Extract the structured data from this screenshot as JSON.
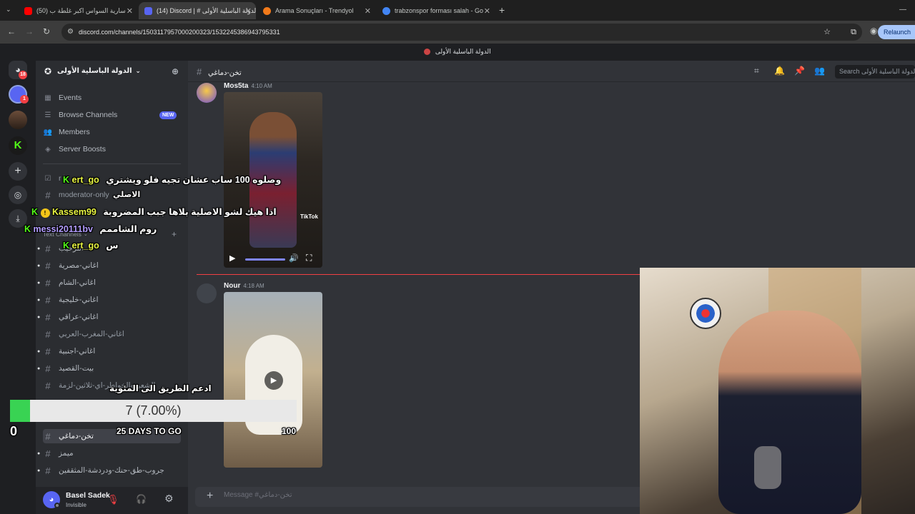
{
  "browser": {
    "tabs": [
      {
        "title": "(50) سارية السواس اكبر غلطة ب"
      },
      {
        "title": "(14) Discord | # الدولة الباسلية الأولى"
      },
      {
        "title": "Arama Sonuçları - Trendyol"
      },
      {
        "title": "trabzonspor forması salah - Go"
      }
    ],
    "url": "discord.com/channels/1503117957000200323/1532245386943795331",
    "relaunch_label": "Relaunch"
  },
  "discord": {
    "top_title": "الدولة الباسلية الأولى",
    "guild_badges": [
      "18",
      "1"
    ],
    "server": {
      "name": "الدولة الباسلية الأولى"
    },
    "nav_items": [
      {
        "label": "Events",
        "icon": "calendar-icon"
      },
      {
        "label": "Browse Channels",
        "icon": "browse-icon",
        "badge": "NEW"
      },
      {
        "label": "Members",
        "icon": "members-icon"
      },
      {
        "label": "Server Boosts",
        "icon": "boost-icon"
      }
    ],
    "partial_channels": [
      {
        "label": "r k"
      },
      {
        "label": "moderator-only"
      }
    ],
    "category_label": "Text Channels",
    "channels": [
      {
        "label": "الترحيب",
        "caret": true
      },
      {
        "label": "اغاني-مصرية",
        "caret": true
      },
      {
        "label": "اغاني-الشام",
        "caret": true
      },
      {
        "label": "اغاني-خليجية",
        "caret": true
      },
      {
        "label": "اغاني-عراقي",
        "caret": true
      },
      {
        "label": "اغاني-المغرب-العربي",
        "caret": false
      },
      {
        "label": "اغاني-اجنبية",
        "caret": true
      },
      {
        "label": "بيت-القصيد",
        "caret": true
      },
      {
        "label": "الشعر-والخواطر-اي-ثلاثين-لزمة",
        "caret": false
      },
      {
        "label": "تخن-دماغي",
        "caret": false
      },
      {
        "label": "ميمز",
        "caret": true
      },
      {
        "label": "جروب-طق-حنك-ودردشة-المثقفين",
        "caret": true
      }
    ],
    "user": {
      "name": "Basel Sadek",
      "status": "Invisible"
    },
    "channel_header": {
      "name": "تخن-دماغي",
      "search_placeholder": "Search الدولة الباسلية الأولى"
    },
    "messages": [
      {
        "author": "Mos5ta",
        "time": "4:10 AM"
      },
      {
        "author": "Nour",
        "time": "4:18 AM"
      }
    ],
    "composer_placeholder": "Message #تخن-دماغي",
    "video_watermark": "TikTok"
  },
  "overlay": {
    "chat": [
      {
        "user": "ert_go",
        "text": "وصلوه 100 ساب عشان تجيه فلو ويشتري",
        "color": "#e8f542"
      },
      {
        "user": "",
        "text": "الاصلي",
        "color": "#e8f542"
      },
      {
        "user": "Kassem99",
        "text": "اذا هيك لشو الاصلية بلاها جبب المضروبة",
        "color": "#e8f542"
      },
      {
        "user": "messi20111bv",
        "text": "روم الشاممم",
        "color": "#b39dff"
      },
      {
        "user": "ert_go",
        "text": "س",
        "color": "#e8f542"
      }
    ],
    "goal_title": "ادعم الطريق الى المئوية",
    "goal_progress_text": "7 (7.00%)",
    "goal_progress": 0.07,
    "goal_start": "0",
    "goal_end": "100",
    "days_left": "25 DAYS TO GO"
  },
  "colors": {
    "accent": "#5865f2",
    "progress_fill": "#39d353",
    "unread": "#f23f43"
  }
}
